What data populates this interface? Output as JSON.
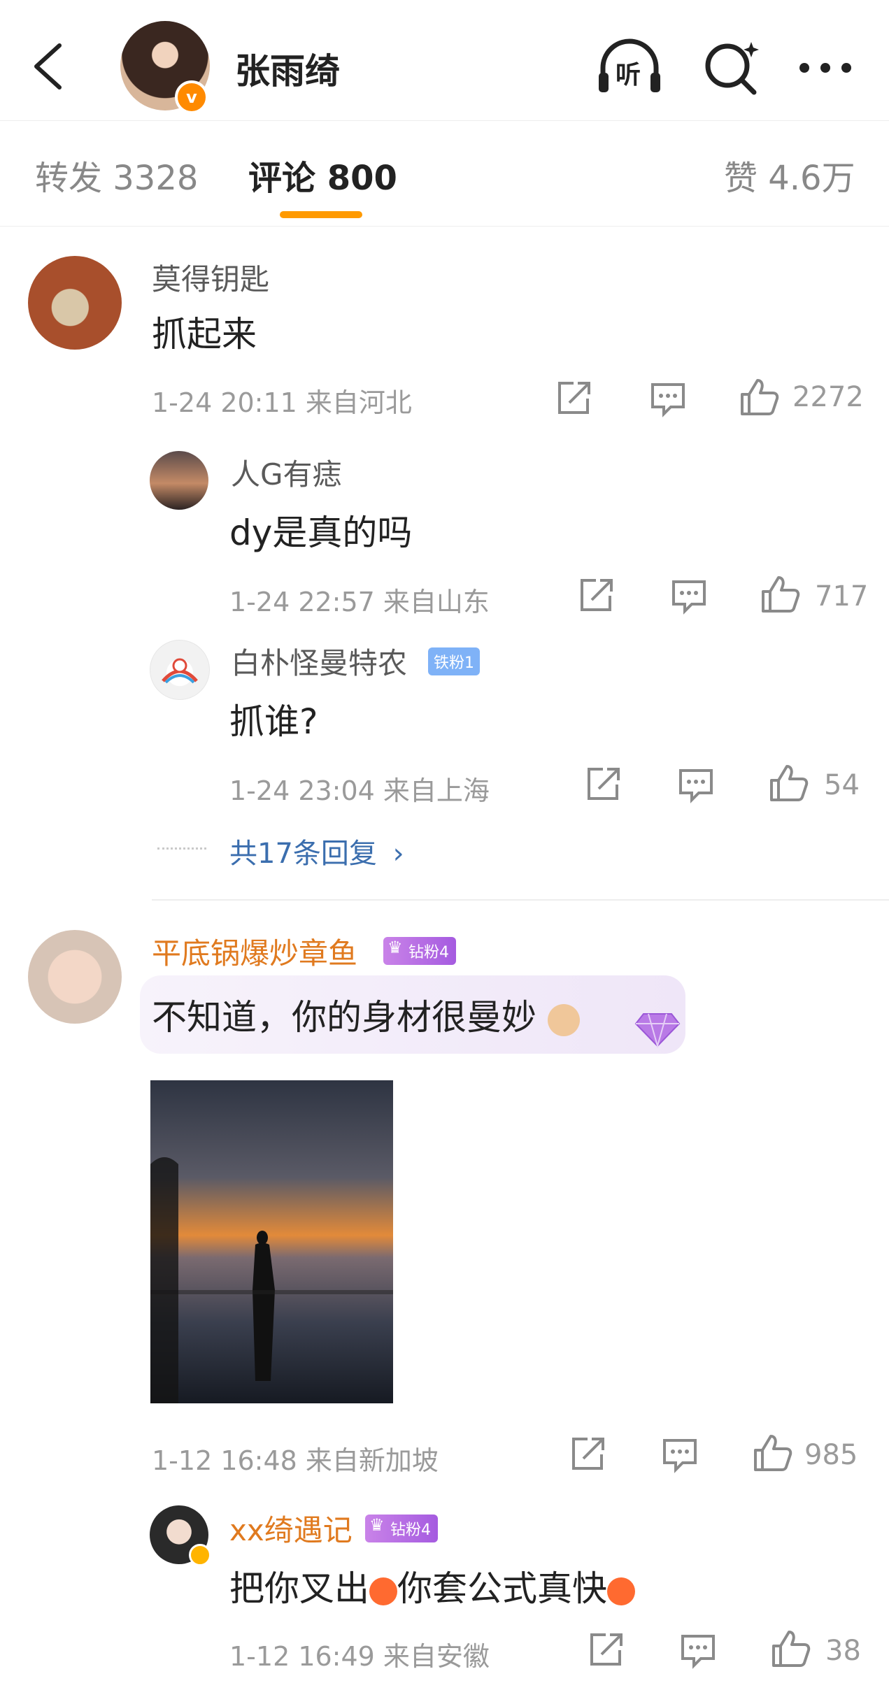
{
  "header": {
    "title": "张雨绮",
    "verified_label": "v",
    "listen_label": "听"
  },
  "tabs": {
    "repost": "转发 3328",
    "comment": "评论 800",
    "like": "赞 4.6万"
  },
  "comments": [
    {
      "user": "莫得钥匙",
      "text": "抓起来",
      "meta": "1-24 20:11 来自河北",
      "likes": "2272",
      "replies": [
        {
          "user": "人G有痣",
          "text": "dy是真的吗",
          "meta": "1-24 22:57 来自山东",
          "likes": "717"
        },
        {
          "user": "白朴怪曼特农",
          "badge": "铁粉1",
          "text": "抓谁?",
          "meta": "1-24 23:04 来自上海",
          "likes": "54"
        }
      ],
      "more_replies": "共17条回复"
    },
    {
      "user": "平底锅爆炒章鱼",
      "badge": "钻粉4",
      "text": "不知道，你的身材很曼妙",
      "meta": "1-12 16:48 来自新加坡",
      "likes": "985",
      "replies": [
        {
          "user": "xx绮遇记",
          "badge": "钻粉4",
          "text_a": "把你叉出",
          "text_b": "你套公式真快",
          "meta": "1-12 16:49 来自安徽",
          "likes": "38"
        }
      ]
    }
  ],
  "colors": {
    "accent_orange": "#ff9a00",
    "link_blue": "#3b6eae",
    "username_orange": "#e07a1f"
  }
}
